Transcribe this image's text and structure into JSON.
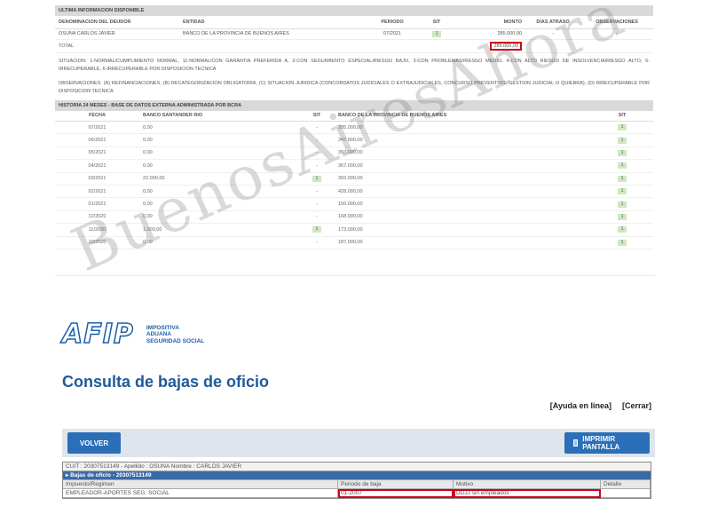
{
  "report": {
    "section1_title": "ULTIMA INFORMACION DISPONIBLE",
    "headers": [
      "DENOMINACION DEL DEUDOR",
      "ENTIDAD",
      "PERIODO",
      "SIT",
      "MONTO",
      "DIAS ATRASO",
      "OBSERVACIONES"
    ],
    "rows": [
      {
        "deudor": "OSUNA CARLOS JAVIER",
        "entidad": "BANCO DE LA PROVINCIA DE BUENOS AIRES",
        "periodo": "07/2021",
        "sit": "1",
        "monto": "285.000,00",
        "dias": "-",
        "obs": "-"
      }
    ],
    "total_label": "TOTAL",
    "total_monto": "285.000,00",
    "situacion_text": "SITUACION: 1-NORMAL/CUMPLIMIENTO NORMAL, 11-NORMAL/CON GARANTIA PREFERIDA A, 2-CON SEGUIMIENTO ESPECIAL/RIESGO BAJO, 3-CON PROBLEMAS/RIESGO MEDIO, 4-CON ALTO RIESGO DE INSOLVENCIA/RIESGO ALTO, 5-IRRECUPERABLE, 6-IRRECUPERABLE POR DISPOSICION TECNICA",
    "observaciones_text": "OBSERVACIONES: (A) REFINANCIACIONES, (B) RECATEGORIZACION OBLIGATORIA, (C) SITUACION JURIDICA (CONCORDATOS JUDICIALES O EXTRAJUDICIALES, CONCURSO PREVENTIVO, GESTION JUDICIAL O QUIEBRA), (D) IRRECUPERABLE POR DISPOSICION TECNICA",
    "section2_title": "HISTORIA 24 MESES - BASE DE DATOS EXTERNA ADMINISTRADA POR BCRA",
    "hist_headers": [
      "FECHA",
      "BANCO SANTANDER RIO",
      "SIT",
      "BANCO DE LA PROVINCIA DE BUENOS AIRES",
      "SIT"
    ],
    "hist_rows": [
      {
        "fecha": "07/2021",
        "santander": "0,00",
        "sit1": "-",
        "provincia": "285.000,00",
        "sit2": "1"
      },
      {
        "fecha": "06/2021",
        "santander": "0,00",
        "sit1": "-",
        "provincia": "347.000,00",
        "sit2": "1"
      },
      {
        "fecha": "05/2021",
        "santander": "0,00",
        "sit1": "-",
        "provincia": "350.000,00",
        "sit2": "1"
      },
      {
        "fecha": "04/2021",
        "santander": "0,00",
        "sit1": "-",
        "provincia": "367.000,00",
        "sit2": "1"
      },
      {
        "fecha": "03/2021",
        "santander": "22.000,00",
        "sit1": "1",
        "provincia": "393.000,00",
        "sit2": "1"
      },
      {
        "fecha": "02/2021",
        "santander": "0,00",
        "sit1": "-",
        "provincia": "428.000,00",
        "sit2": "1"
      },
      {
        "fecha": "01/2021",
        "santander": "0,00",
        "sit1": "-",
        "provincia": "150.000,00",
        "sit2": "1"
      },
      {
        "fecha": "12/2020",
        "santander": "0,00",
        "sit1": "-",
        "provincia": "168.000,00",
        "sit2": "1"
      },
      {
        "fecha": "11/2020",
        "santander": "1.000,00",
        "sit1": "1",
        "provincia": "173.000,00",
        "sit2": "1"
      },
      {
        "fecha": "10/2020",
        "santander": "0,00",
        "sit1": "-",
        "provincia": "187.000,00",
        "sit2": "1"
      }
    ]
  },
  "afip": {
    "logo_text": "AFIP",
    "logo_sub": [
      "IMPOSITIVA",
      "ADUANA",
      "SEGURIDAD SOCIAL"
    ],
    "title": "Consulta de bajas de oficio",
    "help_link": "[Ayuda en linea]",
    "close_link": "[Cerrar]",
    "volver_label": "VOLVER",
    "print_label": "IMPRIMIR PANTALLA",
    "cuit_line": "CUIT : 20307513149 - Apellido : OSUNA Nombre : CARLOS JAVIER",
    "bajas_line": "▸ Bajas de oficio - 20307513149",
    "col_headers": [
      "Impuesto/Regimen",
      "Periodo de baja",
      "Motivo",
      "Detalle"
    ],
    "row": [
      "EMPLEADOR-APORTES SEG. SOCIAL",
      "01-2007",
      "DDJJ sin empleados",
      ""
    ]
  },
  "watermark": "BuenosAiresAhora"
}
